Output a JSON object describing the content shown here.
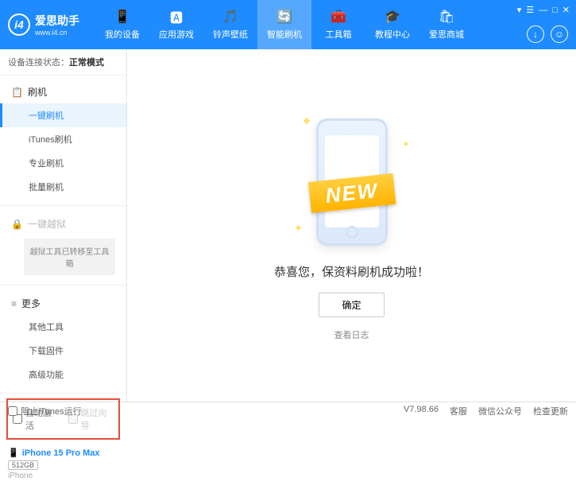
{
  "app": {
    "name": "爱思助手",
    "url": "www.i4.cn"
  },
  "titleControls": {
    "menu": "▾",
    "grid": "☰",
    "min": "—",
    "max": "□",
    "close": "✕"
  },
  "nav": [
    {
      "label": "我的设备",
      "icon": "📱"
    },
    {
      "label": "应用游戏",
      "icon": "🅰"
    },
    {
      "label": "铃声壁纸",
      "icon": "🎵"
    },
    {
      "label": "智能刷机",
      "icon": "🔄",
      "active": true
    },
    {
      "label": "工具箱",
      "icon": "🧰"
    },
    {
      "label": "教程中心",
      "icon": "🎓"
    },
    {
      "label": "爱思商城",
      "icon": "🛍"
    }
  ],
  "connStatus": {
    "label": "设备连接状态：",
    "value": "正常模式"
  },
  "sidebar": {
    "groups": [
      {
        "title": "刷机",
        "icon": "📋",
        "items": [
          {
            "label": "一键刷机",
            "active": true
          },
          {
            "label": "iTunes刷机"
          },
          {
            "label": "专业刷机"
          },
          {
            "label": "批量刷机"
          }
        ]
      },
      {
        "title": "一键越狱",
        "icon": "🔒",
        "locked": true,
        "note": "越狱工具已转移至工具箱"
      },
      {
        "title": "更多",
        "icon": "≡",
        "items": [
          {
            "label": "其他工具"
          },
          {
            "label": "下载固件"
          },
          {
            "label": "高级功能"
          }
        ]
      }
    ],
    "checks": {
      "autoActivate": "自动激活",
      "skipSetup": "跳过向导"
    }
  },
  "device": {
    "name": "iPhone 15 Pro Max",
    "storage": "512GB",
    "type": "iPhone"
  },
  "main": {
    "ribbon": "NEW",
    "message": "恭喜您，保资料刷机成功啦！",
    "okBtn": "确定",
    "logLink": "查看日志"
  },
  "statusbar": {
    "blockItunes": "阻止iTunes运行",
    "version": "V7.98.66",
    "links": [
      "客服",
      "微信公众号",
      "检查更新"
    ]
  }
}
